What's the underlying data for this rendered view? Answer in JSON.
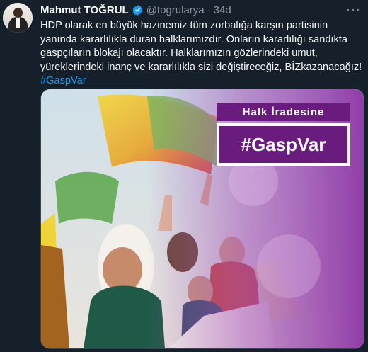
{
  "tweet": {
    "author_name": "Mahmut TOĞRUL",
    "handle": "@togrularya",
    "separator": "·",
    "time": "34d",
    "body": "HDP olarak en büyük hazinemiz tüm zorbalığa karşın partisinin yanında kararlılıkla duran halklarımızdır. Onların kararlılığı sandıkta gaspçıların blokajı olacaktır. Halklarımızın gözlerindeki umut, yüreklerindeki inanç ve kararlılıkla sizi değiştireceğiz, BİZkazanacağız!",
    "hashtag": "#GaspVar",
    "more_label": "···"
  },
  "media": {
    "banner_top": "Halk İradesine",
    "banner_main": "#GaspVar"
  },
  "colors": {
    "background": "#15202b",
    "link": "#1d9bf0",
    "banner_purple": "#6a1b7e",
    "verified": "#1d9bf0"
  }
}
